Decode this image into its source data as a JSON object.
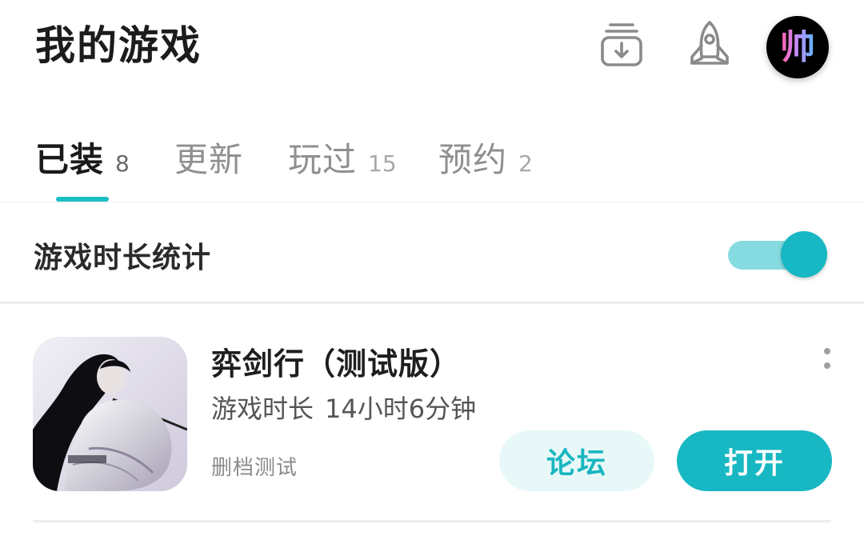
{
  "header": {
    "title": "我的游戏",
    "icons": [
      "download-icon",
      "rocket-icon"
    ],
    "avatar_text": "帅"
  },
  "tabs": [
    {
      "label": "已装",
      "count": "8",
      "active": true
    },
    {
      "label": "更新",
      "count": "",
      "active": false
    },
    {
      "label": "玩过",
      "count": "15",
      "active": false
    },
    {
      "label": "预约",
      "count": "2",
      "active": false
    }
  ],
  "stats": {
    "label": "游戏时长统计",
    "toggle_on": true
  },
  "games": [
    {
      "title": "弈剑行（测试版）",
      "playtime_label": "游戏时长",
      "playtime_value": "14小时6分钟",
      "tag": "删档测试",
      "forum_label": "论坛",
      "open_label": "打开"
    }
  ],
  "colors": {
    "accent": "#17b8c3",
    "toggle_track": "#86dbe0",
    "forum_bg": "#e8f8f9"
  }
}
